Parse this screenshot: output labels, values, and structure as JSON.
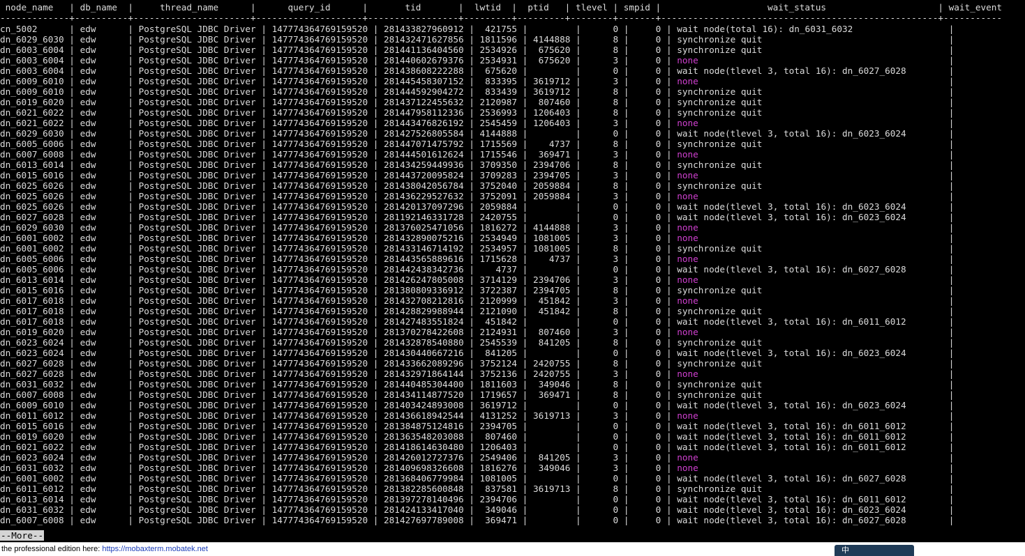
{
  "terminal": {
    "header": " node_name   | db_name  |     thread_name      |      query_id      |       tid       |  lwtid  |  ptid   | tlevel | smpid |                    wait_status                     | wait_event",
    "divider": "-------------+----------+----------------------+--------------------+-----------------+---------+---------+--------+-------+----------------------------------------------------+-----------",
    "rows": [
      [
        "cn_5002",
        "edw",
        "PostgreSQL JDBC Driver",
        "147774364769159520",
        "281433827960912",
        "421755",
        "",
        "0",
        "0",
        "wait node(total 16): dn_6031_6032"
      ],
      [
        "dn_6029_6030",
        "edw",
        "PostgreSQL JDBC Driver",
        "147774364769159520",
        "281432471627856",
        "1811596",
        "4144888",
        "8",
        "0",
        "synchronize quit"
      ],
      [
        "dn_6003_6004",
        "edw",
        "PostgreSQL JDBC Driver",
        "147774364769159520",
        "281441136404560",
        "2534926",
        "675620",
        "8",
        "0",
        "synchronize quit"
      ],
      [
        "dn_6003_6004",
        "edw",
        "PostgreSQL JDBC Driver",
        "147774364769159520",
        "281440602679376",
        "2534931",
        "675620",
        "3",
        "0",
        "none"
      ],
      [
        "dn_6003_6004",
        "edw",
        "PostgreSQL JDBC Driver",
        "147774364769159520",
        "281438608222288",
        "675620",
        "",
        "0",
        "0",
        "wait node(tlevel 3, total 16): dn_6027_6028"
      ],
      [
        "dn_6009_6010",
        "edw",
        "PostgreSQL JDBC Driver",
        "147774364769159520",
        "281445458307152",
        "833395",
        "3619712",
        "3",
        "0",
        "none"
      ],
      [
        "dn_6009_6010",
        "edw",
        "PostgreSQL JDBC Driver",
        "147774364769159520",
        "281444592904272",
        "833439",
        "3619712",
        "8",
        "0",
        "synchronize quit"
      ],
      [
        "dn_6019_6020",
        "edw",
        "PostgreSQL JDBC Driver",
        "147774364769159520",
        "281437122455632",
        "2120987",
        "807460",
        "8",
        "0",
        "synchronize quit"
      ],
      [
        "dn_6021_6022",
        "edw",
        "PostgreSQL JDBC Driver",
        "147774364769159520",
        "281447958112336",
        "2536993",
        "1206403",
        "8",
        "0",
        "synchronize quit"
      ],
      [
        "dn_6021_6022",
        "edw",
        "PostgreSQL JDBC Driver",
        "147774364769159520",
        "281443476826192",
        "2545459",
        "1206403",
        "3",
        "0",
        "none"
      ],
      [
        "dn_6029_6030",
        "edw",
        "PostgreSQL JDBC Driver",
        "147774364769159520",
        "281427526805584",
        "4144888",
        "",
        "0",
        "0",
        "wait node(tlevel 3, total 16): dn_6023_6024"
      ],
      [
        "dn_6005_6006",
        "edw",
        "PostgreSQL JDBC Driver",
        "147774364769159520",
        "281447071475792",
        "1715569",
        "4737",
        "8",
        "0",
        "synchronize quit"
      ],
      [
        "dn_6007_6008",
        "edw",
        "PostgreSQL JDBC Driver",
        "147774364769159520",
        "281444501612624",
        "1715546",
        "369471",
        "3",
        "0",
        "none"
      ],
      [
        "dn_6013_6014",
        "edw",
        "PostgreSQL JDBC Driver",
        "147774364769159520",
        "281434259449936",
        "3709350",
        "2394706",
        "8",
        "0",
        "synchronize quit"
      ],
      [
        "dn_6015_6016",
        "edw",
        "PostgreSQL JDBC Driver",
        "147774364769159520",
        "281443720095824",
        "3709283",
        "2394705",
        "3",
        "0",
        "none"
      ],
      [
        "dn_6025_6026",
        "edw",
        "PostgreSQL JDBC Driver",
        "147774364769159520",
        "281438042056784",
        "3752040",
        "2059884",
        "8",
        "0",
        "synchronize quit"
      ],
      [
        "dn_6025_6026",
        "edw",
        "PostgreSQL JDBC Driver",
        "147774364769159520",
        "281436229527632",
        "3752091",
        "2059884",
        "3",
        "0",
        "none"
      ],
      [
        "dn_6025_6026",
        "edw",
        "PostgreSQL JDBC Driver",
        "147774364769159520",
        "281420137097296",
        "2059884",
        "",
        "0",
        "0",
        "wait node(tlevel 3, total 16): dn_6023_6024"
      ],
      [
        "dn_6027_6028",
        "edw",
        "PostgreSQL JDBC Driver",
        "147774364769159520",
        "281192146331728",
        "2420755",
        "",
        "0",
        "0",
        "wait node(tlevel 3, total 16): dn_6023_6024"
      ],
      [
        "dn_6029_6030",
        "edw",
        "PostgreSQL JDBC Driver",
        "147774364769159520",
        "281376025471056",
        "1816272",
        "4144888",
        "3",
        "0",
        "none"
      ],
      [
        "dn_6001_6002",
        "edw",
        "PostgreSQL JDBC Driver",
        "147774364769159520",
        "281432890075216",
        "2534949",
        "1081005",
        "3",
        "0",
        "none"
      ],
      [
        "dn_6001_6002",
        "edw",
        "PostgreSQL JDBC Driver",
        "147774364769159520",
        "281433146714192",
        "2534957",
        "1081005",
        "8",
        "0",
        "synchronize quit"
      ],
      [
        "dn_6005_6006",
        "edw",
        "PostgreSQL JDBC Driver",
        "147774364769159520",
        "281443565889616",
        "1715628",
        "4737",
        "3",
        "0",
        "none"
      ],
      [
        "dn_6005_6006",
        "edw",
        "PostgreSQL JDBC Driver",
        "147774364769159520",
        "281442438342736",
        "4737",
        "",
        "0",
        "0",
        "wait node(tlevel 3, total 16): dn_6027_6028"
      ],
      [
        "dn_6013_6014",
        "edw",
        "PostgreSQL JDBC Driver",
        "147774364769159520",
        "281426247805008",
        "3714129",
        "2394706",
        "3",
        "0",
        "none"
      ],
      [
        "dn_6015_6016",
        "edw",
        "PostgreSQL JDBC Driver",
        "147774364769159520",
        "281380809336912",
        "3722387",
        "2394705",
        "8",
        "0",
        "synchronize quit"
      ],
      [
        "dn_6017_6018",
        "edw",
        "PostgreSQL JDBC Driver",
        "147774364769159520",
        "281432708212816",
        "2120999",
        "451842",
        "3",
        "0",
        "none"
      ],
      [
        "dn_6017_6018",
        "edw",
        "PostgreSQL JDBC Driver",
        "147774364769159520",
        "281428829988944",
        "2121090",
        "451842",
        "8",
        "0",
        "synchronize quit"
      ],
      [
        "dn_6017_6018",
        "edw",
        "PostgreSQL JDBC Driver",
        "147774364769159520",
        "281427483551824",
        "451842",
        "",
        "0",
        "0",
        "wait node(tlevel 3, total 16): dn_6011_6012"
      ],
      [
        "dn_6019_6020",
        "edw",
        "PostgreSQL JDBC Driver",
        "147774364769159520",
        "281370278422608",
        "2124931",
        "807460",
        "3",
        "0",
        "none"
      ],
      [
        "dn_6023_6024",
        "edw",
        "PostgreSQL JDBC Driver",
        "147774364769159520",
        "281432878540880",
        "2545539",
        "841205",
        "8",
        "0",
        "synchronize quit"
      ],
      [
        "dn_6023_6024",
        "edw",
        "PostgreSQL JDBC Driver",
        "147774364769159520",
        "281430440667216",
        "841205",
        "",
        "0",
        "0",
        "wait node(tlevel 3, total 16): dn_6023_6024"
      ],
      [
        "dn_6027_6028",
        "edw",
        "PostgreSQL JDBC Driver",
        "147774364769159520",
        "281433662089296",
        "3752124",
        "2420755",
        "8",
        "0",
        "synchronize quit"
      ],
      [
        "dn_6027_6028",
        "edw",
        "PostgreSQL JDBC Driver",
        "147774364769159520",
        "281432971864144",
        "3752136",
        "2420755",
        "3",
        "0",
        "none"
      ],
      [
        "dn_6031_6032",
        "edw",
        "PostgreSQL JDBC Driver",
        "147774364769159520",
        "281440485304400",
        "1811603",
        "349046",
        "8",
        "0",
        "synchronize quit"
      ],
      [
        "dn_6007_6008",
        "edw",
        "PostgreSQL JDBC Driver",
        "147774364769159520",
        "281434114877520",
        "1719657",
        "369471",
        "8",
        "0",
        "synchronize quit"
      ],
      [
        "dn_6009_6010",
        "edw",
        "PostgreSQL JDBC Driver",
        "147774364769159520",
        "281403424893008",
        "3619712",
        "",
        "0",
        "0",
        "wait node(tlevel 3, total 16): dn_6023_6024"
      ],
      [
        "dn_6011_6012",
        "edw",
        "PostgreSQL JDBC Driver",
        "147774364769159520",
        "281436618942544",
        "4131252",
        "3619713",
        "3",
        "0",
        "none"
      ],
      [
        "dn_6015_6016",
        "edw",
        "PostgreSQL JDBC Driver",
        "147774364769159520",
        "281384875124816",
        "2394705",
        "",
        "0",
        "0",
        "wait node(tlevel 3, total 16): dn_6011_6012"
      ],
      [
        "dn_6019_6020",
        "edw",
        "PostgreSQL JDBC Driver",
        "147774364769159520",
        "281363548203088",
        "807460",
        "",
        "0",
        "0",
        "wait node(tlevel 3, total 16): dn_6011_6012"
      ],
      [
        "dn_6021_6022",
        "edw",
        "PostgreSQL JDBC Driver",
        "147774364769159520",
        "281418614630480",
        "1206403",
        "",
        "0",
        "0",
        "wait node(tlevel 3, total 16): dn_6011_6012"
      ],
      [
        "dn_6023_6024",
        "edw",
        "PostgreSQL JDBC Driver",
        "147774364769159520",
        "281426012727376",
        "2549406",
        "841205",
        "3",
        "0",
        "none"
      ],
      [
        "dn_6031_6032",
        "edw",
        "PostgreSQL JDBC Driver",
        "147774364769159520",
        "281409698326608",
        "1816276",
        "349046",
        "3",
        "0",
        "none"
      ],
      [
        "dn_6001_6002",
        "edw",
        "PostgreSQL JDBC Driver",
        "147774364769159520",
        "281368406779984",
        "1081005",
        "",
        "0",
        "0",
        "wait node(tlevel 3, total 16): dn_6027_6028"
      ],
      [
        "dn_6011_6012",
        "edw",
        "PostgreSQL JDBC Driver",
        "147774364769159520",
        "281382285600848",
        "837581",
        "3619713",
        "8",
        "0",
        "synchronize quit"
      ],
      [
        "dn_6013_6014",
        "edw",
        "PostgreSQL JDBC Driver",
        "147774364769159520",
        "281397278140496",
        "2394706",
        "",
        "0",
        "0",
        "wait node(tlevel 3, total 16): dn_6011_6012"
      ],
      [
        "dn_6031_6032",
        "edw",
        "PostgreSQL JDBC Driver",
        "147774364769159520",
        "281424133417040",
        "349046",
        "",
        "0",
        "0",
        "wait node(tlevel 3, total 16): dn_6023_6024"
      ],
      [
        "dn_6007_6008",
        "edw",
        "PostgreSQL JDBC Driver",
        "147774364769159520",
        "281427697789008",
        "369471",
        "",
        "0",
        "0",
        "wait node(tlevel 3, total 16): dn_6027_6028"
      ]
    ],
    "pager": "--More--"
  },
  "statusbar": {
    "text": "the professional edition here:",
    "link": "https://mobaxterm.mobatek.net"
  },
  "tray": {
    "label": "中"
  },
  "colors": {
    "none_value": "#d040d0",
    "text": "#dcdcdc",
    "background": "#000000"
  }
}
